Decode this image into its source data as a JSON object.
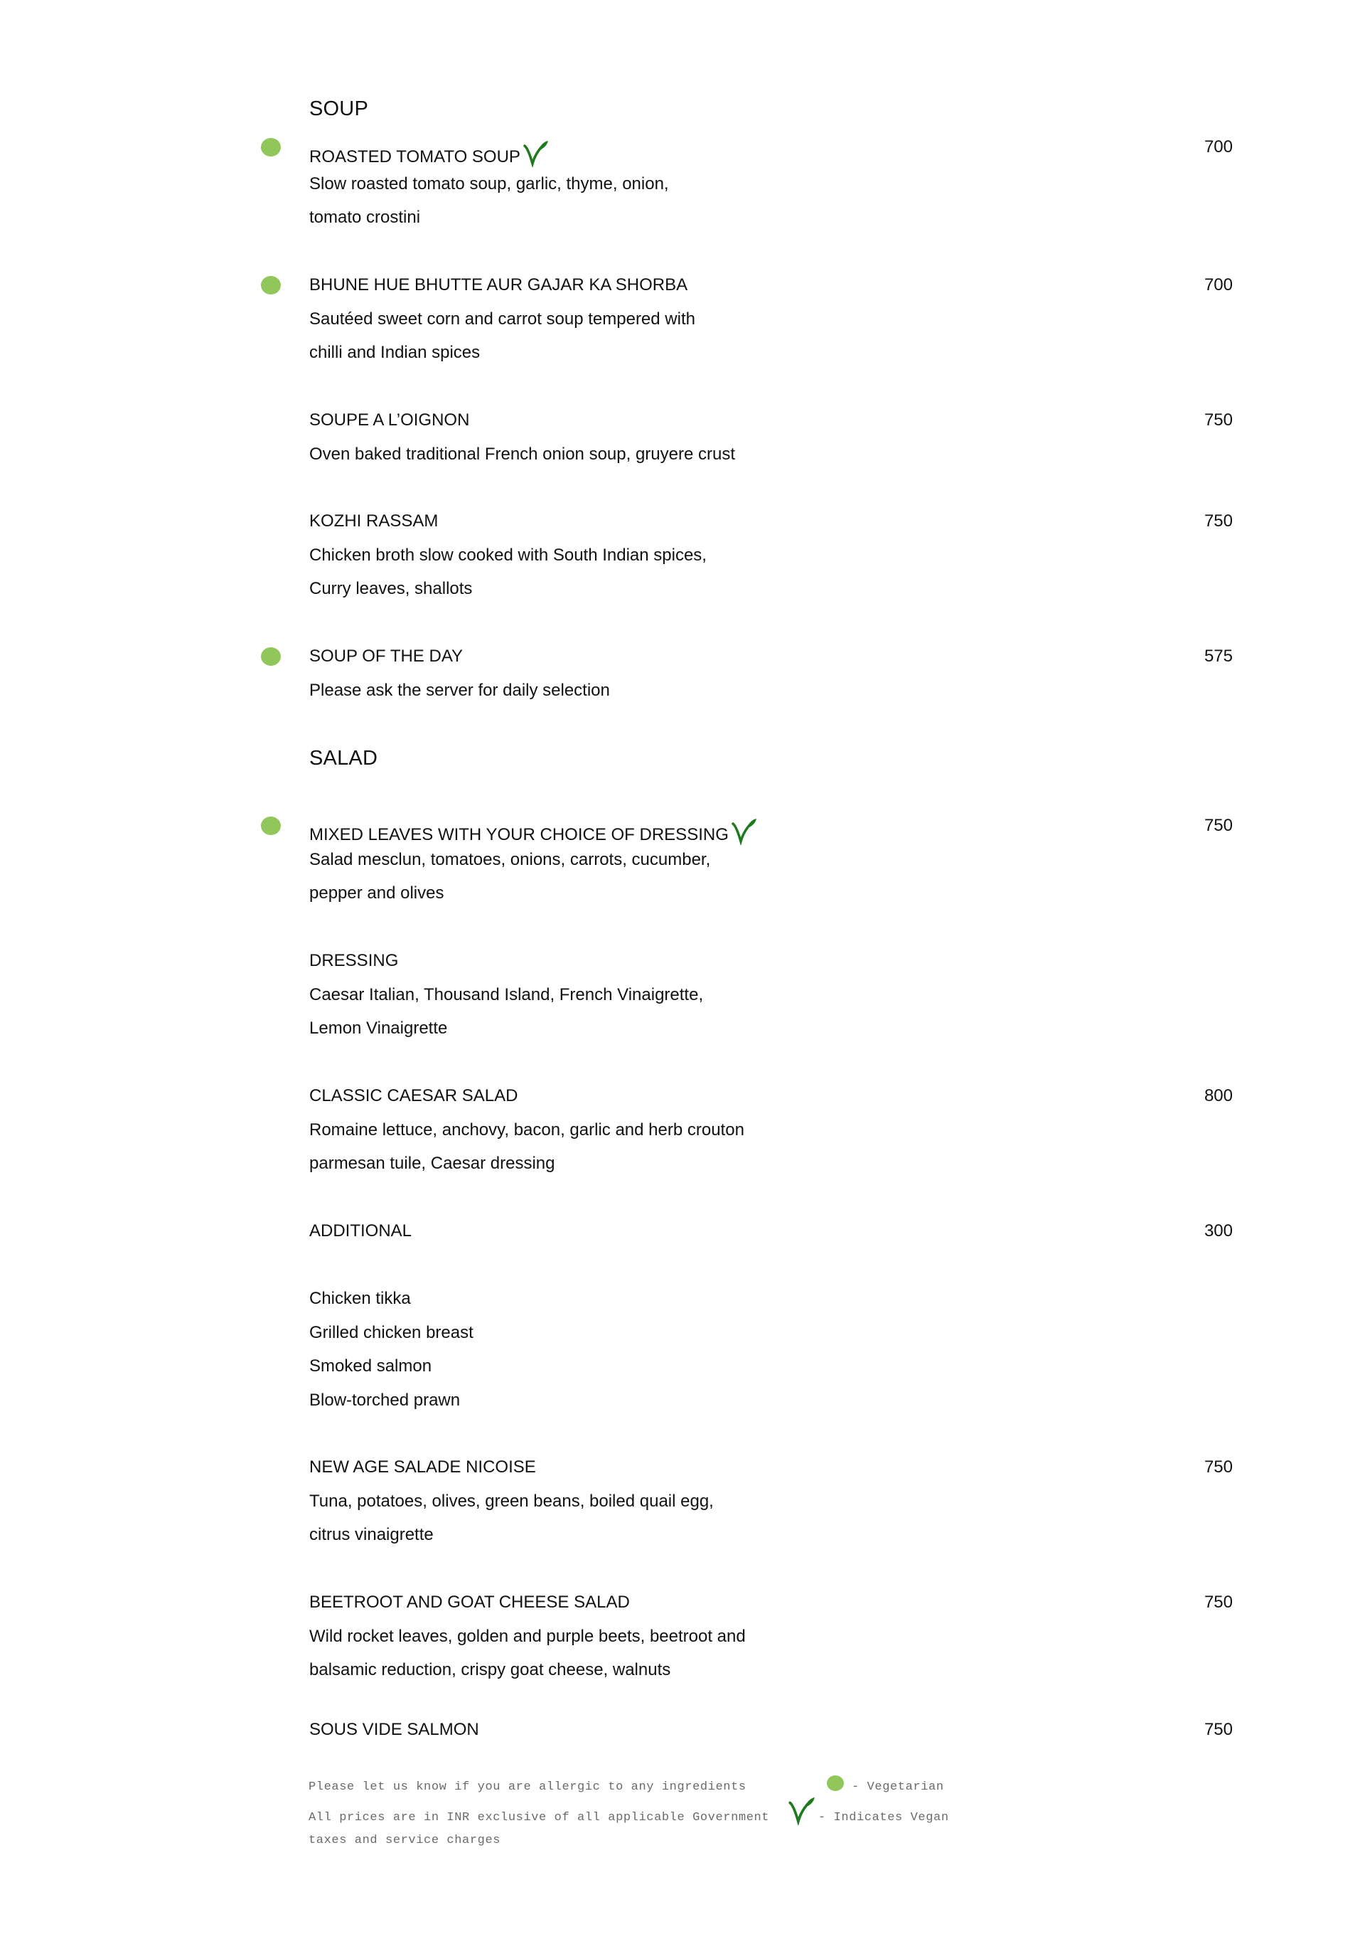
{
  "colors": {
    "vegetarian_dot": "#90c65a",
    "vegan_icon": "#1d7a1d"
  },
  "sections": {
    "soup": {
      "title": "SOUP"
    },
    "salad": {
      "title": "SALAD"
    }
  },
  "items": [
    {
      "name": "ROASTED TOMATO SOUP",
      "price": "700",
      "vegetarian": true,
      "vegan": true,
      "lines": [
        "Slow roasted tomato soup, garlic, thyme, onion,",
        "tomato crostini"
      ]
    },
    {
      "name": "BHUNE HUE BHUTTE AUR GAJAR KA SHORBA",
      "price": "700",
      "vegetarian": true,
      "vegan": false,
      "lines": [
        "Sautéed sweet corn and carrot soup tempered with",
        "chilli and Indian spices"
      ]
    },
    {
      "name": "SOUPE A L’OIGNON",
      "price": "750",
      "vegetarian": false,
      "vegan": false,
      "lines": [
        "Oven baked traditional French onion soup, gruyere crust"
      ]
    },
    {
      "name": "KOZHI RASSAM",
      "price": "750",
      "vegetarian": false,
      "vegan": false,
      "lines": [
        "Chicken broth slow cooked with South Indian spices,",
        "Curry leaves, shallots"
      ]
    },
    {
      "name": "SOUP OF THE DAY",
      "price": "575",
      "vegetarian": true,
      "vegan": false,
      "lines": [
        "Please ask the server for daily selection"
      ]
    },
    {
      "name": "MIXED LEAVES WITH YOUR CHOICE OF DRESSING",
      "price": "750",
      "vegetarian": true,
      "vegan": true,
      "lines": [
        "Salad mesclun, tomatoes, onions, carrots, cucumber,",
        "pepper and olives"
      ]
    },
    {
      "name": "DRESSING",
      "price": "",
      "vegetarian": false,
      "vegan": false,
      "lines": [
        "Caesar Italian, Thousand Island, French Vinaigrette,",
        "Lemon Vinaigrette"
      ]
    },
    {
      "name": "CLASSIC CAESAR SALAD",
      "price": "800",
      "vegetarian": false,
      "vegan": false,
      "lines": [
        "Romaine lettuce, anchovy, bacon, garlic and herb crouton",
        "parmesan tuile, Caesar dressing"
      ]
    },
    {
      "name": "ADDITIONAL",
      "price": "300",
      "vegetarian": false,
      "vegan": false,
      "lines": []
    },
    {
      "name": "",
      "price": "",
      "vegetarian": false,
      "vegan": false,
      "lines": [
        "Chicken tikka",
        "Grilled chicken breast",
        "Smoked salmon",
        "Blow-torched prawn"
      ]
    },
    {
      "name": "NEW AGE SALADE NICOISE",
      "price": "750",
      "vegetarian": false,
      "vegan": false,
      "lines": [
        "Tuna, potatoes, olives, green beans,  boiled quail egg,",
        "citrus vinaigrette"
      ]
    },
    {
      "name": "BEETROOT AND GOAT CHEESE SALAD",
      "price": "750",
      "vegetarian": false,
      "vegan": false,
      "lines": [
        "Wild rocket leaves, golden and purple beets, beetroot and",
        "balsamic reduction, crispy goat cheese, walnuts"
      ]
    },
    {
      "name": "SOUS VIDE SALMON",
      "price": "750",
      "vegetarian": false,
      "vegan": false,
      "lines": []
    }
  ],
  "footer": {
    "allergy_note": "Please let us know if you are allergic to any ingredients",
    "prices_note_1": "All prices are in INR exclusive of all applicable Government",
    "prices_note_2": "taxes and service charges",
    "legend_vegetarian": "- Vegetarian",
    "legend_vegan": "- Indicates Vegan"
  }
}
